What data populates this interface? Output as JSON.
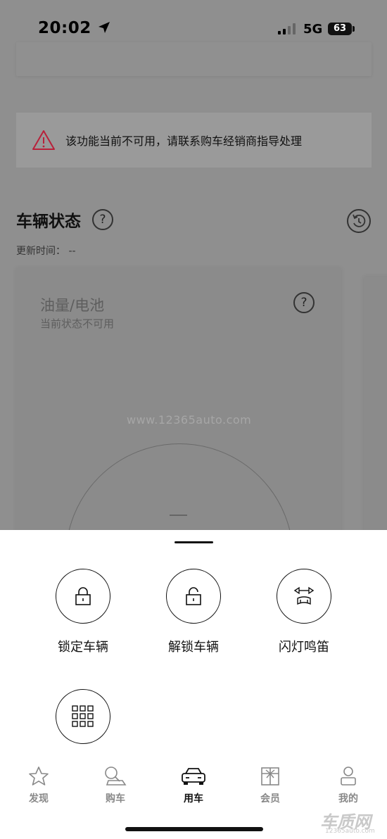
{
  "status_bar": {
    "time": "20:02",
    "network": "5G",
    "battery": "63"
  },
  "alert": {
    "text": "该功能当前不可用，请联系购车经销商指导处理"
  },
  "vehicle_status": {
    "title": "车辆状态",
    "help": "?",
    "update_label": "更新时间：",
    "update_value": "--",
    "card": {
      "title": "油量/电池",
      "subtitle": "当前状态不可用",
      "help": "?",
      "gauge_value": "—"
    }
  },
  "watermark": "www.12365auto.com",
  "actions": [
    {
      "label": "锁定车辆",
      "icon": "lock-icon"
    },
    {
      "label": "解锁车辆",
      "icon": "unlock-icon"
    },
    {
      "label": "闪灯鸣笛",
      "icon": "flash-horn-icon"
    },
    {
      "label": "",
      "icon": "grid-icon"
    }
  ],
  "tabs": [
    {
      "label": "发现",
      "icon": "star-icon",
      "active": false
    },
    {
      "label": "购车",
      "icon": "buy-car-icon",
      "active": false
    },
    {
      "label": "用车",
      "icon": "car-icon",
      "active": true
    },
    {
      "label": "会员",
      "icon": "gift-icon",
      "active": false
    },
    {
      "label": "我的",
      "icon": "profile-icon",
      "active": false
    }
  ],
  "corner_logo": {
    "text": "车质网",
    "url": "12365auto.com"
  },
  "colors": {
    "alert_icon": "#b8213a",
    "overlay": "#8f8f8f",
    "sheet": "#ffffff"
  }
}
